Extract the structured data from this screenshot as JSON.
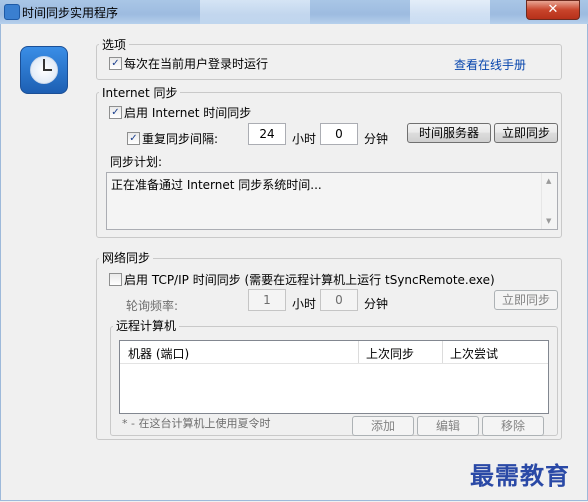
{
  "window": {
    "title": "时间同步实用程序",
    "close_glyph": "✕"
  },
  "options": {
    "group_label": "选项",
    "run_on_login": {
      "label": "每次在当前用户登录时运行",
      "checked": true
    },
    "manual_link": "查看在线手册"
  },
  "internet_sync": {
    "group_label": "Internet 同步",
    "enable": {
      "label": "启用 Internet 时间同步",
      "checked": true
    },
    "repeat": {
      "label": "重复同步间隔:",
      "checked": true
    },
    "hours_value": "24",
    "hours_unit": "小时",
    "minutes_value": "0",
    "minutes_unit": "分钟",
    "time_server_button": "时间服务器",
    "sync_now_button": "立即同步",
    "schedule_label": "同步计划:",
    "status_text": "正在准备通过 Internet 同步系统时间..."
  },
  "network_sync": {
    "group_label": "网络同步",
    "enable": {
      "label": "启用 TCP/IP 时间同步 (需要在远程计算机上运行 tSyncRemote.exe)",
      "checked": false
    },
    "poll_label": "轮询频率:",
    "hours_value": "1",
    "hours_unit": "小时",
    "minutes_value": "0",
    "minutes_unit": "分钟",
    "sync_now_button": "立即同步",
    "remote_group_label": "远程计算机",
    "columns": [
      "机器 (端口)",
      "上次同步",
      "上次尝试"
    ],
    "rows": [],
    "dst_note": "* - 在这台计算机上使用夏令时",
    "add_button": "添加",
    "edit_button": "编辑",
    "remove_button": "移除"
  },
  "watermark": "最需教育"
}
